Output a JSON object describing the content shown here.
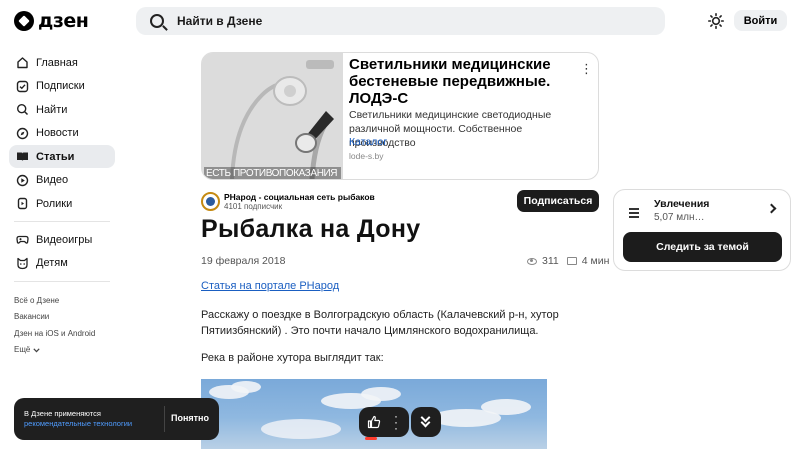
{
  "header": {
    "logo_text": "дзен",
    "search_placeholder": "Найти в Дзене",
    "login_label": "Войти"
  },
  "sidebar": {
    "items": [
      {
        "label": "Главная",
        "icon": "home-icon"
      },
      {
        "label": "Подписки",
        "icon": "subscriptions-icon"
      },
      {
        "label": "Найти",
        "icon": "search-icon"
      },
      {
        "label": "Новости",
        "icon": "news-icon"
      },
      {
        "label": "Статьи",
        "icon": "articles-icon",
        "active": true
      },
      {
        "label": "Видео",
        "icon": "video-icon"
      },
      {
        "label": "Ролики",
        "icon": "clips-icon"
      },
      {
        "label": "Видеоигры",
        "icon": "gamepad-icon"
      },
      {
        "label": "Детям",
        "icon": "kids-icon"
      }
    ],
    "footer_links": [
      "Всё о Дзене",
      "Вакансии",
      "Дзен на iOS и Android",
      "Ещё"
    ]
  },
  "ad": {
    "title": "Светильники медицинские бестеневые передвижные. ЛОДЭ-С",
    "description": "Светильники медицинские светодиодные различной мощности. Собственное производство",
    "category": "Каталог",
    "domain": "lode-s.by",
    "image_warning": "ЕСТЬ ПРОТИВОПОКАЗАНИЯ"
  },
  "channel": {
    "name": "РНарод - социальная сеть рыбаков",
    "subscribers": "4101 подписчик",
    "subscribe_label": "Подписаться"
  },
  "article": {
    "title": "Рыбалка на Дону",
    "date": "19 февраля 2018",
    "views": "311",
    "read_time": "4 мин",
    "link_text": "Статья на портале РНарод",
    "paragraph1": "Расскажу о поездке в Волгоградскую область (Калачевский р-н, хутор Пятиизбянский) . Это почти начало Цимлянского водохранилища.",
    "paragraph2": "Река в районе хутора выглядит так:"
  },
  "topic": {
    "name": "Увлечения",
    "count": "5,07 млн…",
    "follow_label": "Следить за темой"
  },
  "cookie": {
    "text": "В Дзене применяются",
    "link": "рекомендательные технологии",
    "ok_label": "Понятно"
  },
  "colors": {
    "accent_link": "#1a5ec1",
    "dark_button": "#1c1c1c",
    "search_bg": "#eef0f2"
  }
}
